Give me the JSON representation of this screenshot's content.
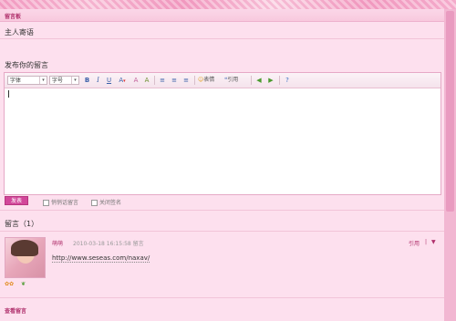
{
  "header": {
    "title": "留言板"
  },
  "owner_section": {
    "title": "主人寄语"
  },
  "compose": {
    "title": "发布你的留言",
    "font_select": "字体",
    "size_select": "字号",
    "emoticon_label": "表情",
    "quote_label": "引用",
    "submit_label": "发表",
    "option_private": "悄悄话留言",
    "option_anon": "关闭签名"
  },
  "messages": {
    "title": "留言（1）",
    "items": [
      {
        "author": "萌萌",
        "time": "2010-03-18 16:15:58 留言",
        "body": "http://www.seseas.com/naxav/",
        "reply_label": "引用"
      }
    ],
    "footer_link": "查看留言"
  },
  "colors": {
    "accent": "#b0306c",
    "button": "#d2479a",
    "panel_bg": "#fde0ee",
    "border": "#e6a9c6"
  }
}
